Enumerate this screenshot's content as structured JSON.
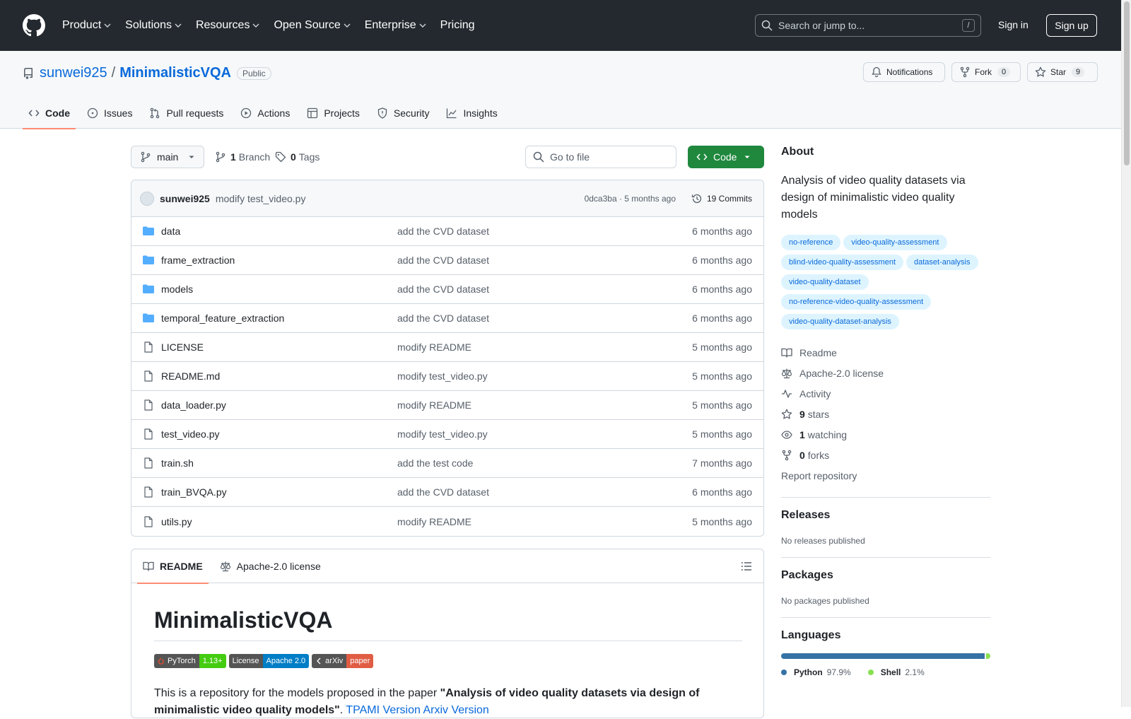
{
  "header": {
    "nav": [
      "Product",
      "Solutions",
      "Resources",
      "Open Source",
      "Enterprise",
      "Pricing"
    ],
    "search_placeholder": "Search or jump to...",
    "search_shortcut": "/",
    "sign_in": "Sign in",
    "sign_up": "Sign up"
  },
  "repo": {
    "owner": "sunwei925",
    "separator": "/",
    "name": "MinimalisticVQA",
    "visibility": "Public",
    "notifications_label": "Notifications",
    "fork_label": "Fork",
    "fork_count": "0",
    "star_label": "Star",
    "star_count": "9",
    "tabs": [
      "Code",
      "Issues",
      "Pull requests",
      "Actions",
      "Projects",
      "Security",
      "Insights"
    ]
  },
  "toolbar": {
    "branch": "main",
    "branch_count": "1",
    "branch_label": "Branch",
    "tag_count": "0",
    "tag_label": "Tags",
    "goto_placeholder": "Go to file",
    "code_button": "Code"
  },
  "commit": {
    "author": "sunwei925",
    "message": "modify test_video.py",
    "hash_time": "0dca3ba · 5 months ago",
    "commits": "19 Commits"
  },
  "files": [
    {
      "name": "data",
      "type": "dir",
      "message": "add the CVD dataset",
      "date": "6 months ago"
    },
    {
      "name": "frame_extraction",
      "type": "dir",
      "message": "add the CVD dataset",
      "date": "6 months ago"
    },
    {
      "name": "models",
      "type": "dir",
      "message": "add the CVD dataset",
      "date": "6 months ago"
    },
    {
      "name": "temporal_feature_extraction",
      "type": "dir",
      "message": "add the CVD dataset",
      "date": "6 months ago"
    },
    {
      "name": "LICENSE",
      "type": "file",
      "message": "modify README",
      "date": "5 months ago"
    },
    {
      "name": "README.md",
      "type": "file",
      "message": "modify test_video.py",
      "date": "5 months ago"
    },
    {
      "name": "data_loader.py",
      "type": "file",
      "message": "modify README",
      "date": "5 months ago"
    },
    {
      "name": "test_video.py",
      "type": "file",
      "message": "modify test_video.py",
      "date": "5 months ago"
    },
    {
      "name": "train.sh",
      "type": "file",
      "message": "add the test code",
      "date": "7 months ago"
    },
    {
      "name": "train_BVQA.py",
      "type": "file",
      "message": "add the CVD dataset",
      "date": "6 months ago"
    },
    {
      "name": "utils.py",
      "type": "file",
      "message": "modify README",
      "date": "5 months ago"
    }
  ],
  "readme": {
    "tab_readme": "README",
    "tab_license": "Apache-2.0 license",
    "title": "MinimalisticVQA",
    "badges": [
      {
        "left": "PyTorch",
        "right": "1.13+",
        "color": "#4c1"
      },
      {
        "left": "License",
        "right": "Apache 2.0",
        "color": "#007ec6"
      },
      {
        "left": "arXiv",
        "right": "paper",
        "color": "#e05d44"
      }
    ],
    "para_prefix": "This is a repository for the models proposed in the paper ",
    "para_bold": "\"Analysis of video quality datasets via design of minimalistic video quality models\"",
    "para_link1": "TPAMI Version",
    "para_link2": "Arxiv Version"
  },
  "about": {
    "heading": "About",
    "description": "Analysis of video quality datasets via design of minimalistic video quality models",
    "topics": [
      "no-reference",
      "video-quality-assessment",
      "blind-video-quality-assessment",
      "dataset-analysis",
      "video-quality-dataset",
      "no-reference-video-quality-assessment",
      "video-quality-dataset-analysis"
    ],
    "readme": "Readme",
    "license": "Apache-2.0 license",
    "activity": "Activity",
    "stars_count": "9",
    "stars_label": "stars",
    "watching_count": "1",
    "watching_label": "watching",
    "forks_count": "0",
    "forks_label": "forks",
    "report": "Report repository"
  },
  "releases": {
    "heading": "Releases",
    "text": "No releases published"
  },
  "packages": {
    "heading": "Packages",
    "text": "No packages published"
  },
  "languages": {
    "heading": "Languages",
    "items": [
      {
        "name": "Python",
        "percent": "97.9%",
        "value": 97.9,
        "color": "#3572A5"
      },
      {
        "name": "Shell",
        "percent": "2.1%",
        "value": 2.1,
        "color": "#89e051"
      }
    ]
  }
}
